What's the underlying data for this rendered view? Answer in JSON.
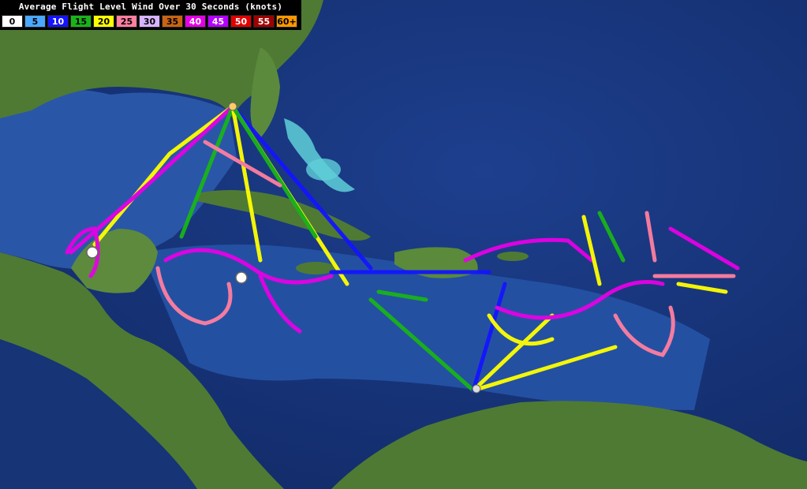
{
  "legend": {
    "title": "Average Flight Level Wind Over 30 Seconds (knots)",
    "bins": [
      {
        "label": "0",
        "color": "#ffffff",
        "text": "#000000"
      },
      {
        "label": "5",
        "color": "#4aa8ff",
        "text": "#000000"
      },
      {
        "label": "10",
        "color": "#1414ff",
        "text": "#ffffff"
      },
      {
        "label": "15",
        "color": "#19b419",
        "text": "#000000"
      },
      {
        "label": "20",
        "color": "#ffff00",
        "text": "#000000"
      },
      {
        "label": "25",
        "color": "#ff7fa0",
        "text": "#000000"
      },
      {
        "label": "30",
        "color": "#d8b4ff",
        "text": "#000000"
      },
      {
        "label": "35",
        "color": "#c86414",
        "text": "#000000"
      },
      {
        "label": "40",
        "color": "#e600e6",
        "text": "#ffffff"
      },
      {
        "label": "45",
        "color": "#b400ff",
        "text": "#ffffff"
      },
      {
        "label": "50",
        "color": "#e00000",
        "text": "#ffffff"
      },
      {
        "label": "55",
        "color": "#a00000",
        "text": "#ffffff"
      },
      {
        "label": "60+",
        "color": "#ff9900",
        "text": "#000000"
      }
    ]
  },
  "map": {
    "colors": {
      "ocean_deep": "#142d6e",
      "ocean": "#1f4ea0",
      "shelf": "#4a86d0",
      "shoal": "#5fd0d8",
      "land": "#4f7a34",
      "land_light": "#7a9a4a"
    }
  }
}
